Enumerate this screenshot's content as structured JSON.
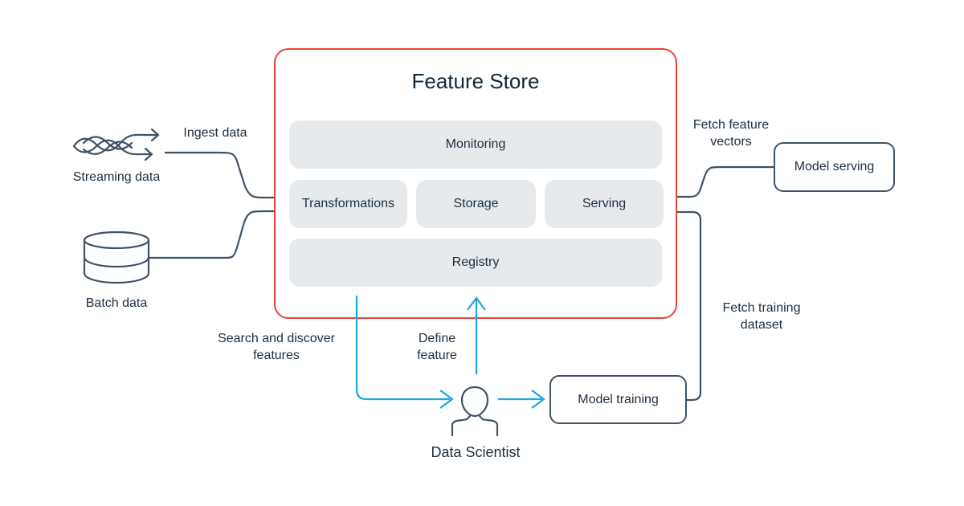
{
  "title": "Feature Store",
  "colors": {
    "store_border": "#e8443a",
    "connector": "#3f5266",
    "flow_accent": "#1aa8e0",
    "component_bg": "#e6eaed",
    "text": "#1c2e40"
  },
  "components": {
    "monitoring": "Monitoring",
    "transformations": "Transformations",
    "storage": "Storage",
    "serving": "Serving",
    "registry": "Registry"
  },
  "sources": {
    "streaming": {
      "label": "Streaming data",
      "icon": "streaming-data-icon"
    },
    "batch": {
      "label": "Batch data",
      "icon": "database-icon"
    }
  },
  "nodes": {
    "model_serving": "Model serving",
    "model_training": "Model training",
    "data_scientist": {
      "label": "Data Scientist",
      "icon": "person-icon"
    }
  },
  "edges": {
    "ingest": "Ingest data",
    "fetch_vectors_line1": "Fetch feature",
    "fetch_vectors_line2": "vectors",
    "fetch_training_line1": "Fetch training",
    "fetch_training_line2": "dataset",
    "search_line1": "Search and discover",
    "search_line2": "features",
    "define_line1": "Define",
    "define_line2": "feature"
  }
}
